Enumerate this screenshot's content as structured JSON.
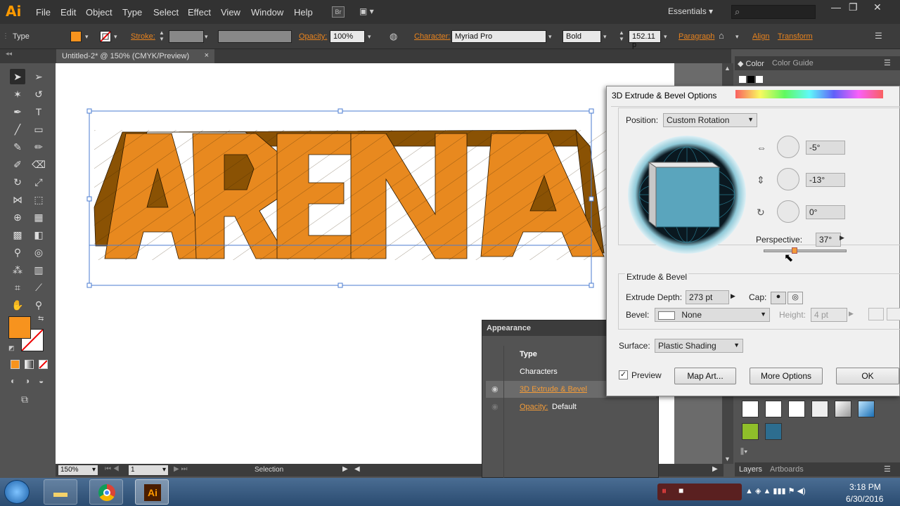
{
  "app": {
    "logo": "Ai",
    "br_label": "Br"
  },
  "menu": [
    "File",
    "Edit",
    "Object",
    "Type",
    "Select",
    "Effect",
    "View",
    "Window",
    "Help"
  ],
  "workspace": "Essentials",
  "control": {
    "mode_label": "Type",
    "stroke_label": "Stroke:",
    "opacity_label": "Opacity:",
    "opacity_value": "100%",
    "character_label": "Character:",
    "font_family": "Myriad Pro",
    "font_style": "Bold",
    "font_size": "152.11 p",
    "paragraph_label": "Paragraph",
    "align_label": "Align",
    "transform_label": "Transform",
    "fill_color": "#f7931e"
  },
  "document_tab": {
    "title": "Untitled-2* @ 150% (CMYK/Preview)",
    "close": "×"
  },
  "artwork": {
    "text": "ARENA",
    "face_color": "#e8891f",
    "side_color": "#8a5204"
  },
  "status": {
    "zoom": "150%",
    "artboard": "1",
    "tool": "Selection"
  },
  "dialog": {
    "title": "3D Extrude & Bevel Options",
    "position_label": "Position:",
    "position_value": "Custom Rotation",
    "rot_x": "-5°",
    "rot_y": "-13°",
    "rot_z": "0°",
    "perspective_label": "Perspective:",
    "perspective_value": "37°",
    "perspective_level": 0.37,
    "extrude_section": "Extrude & Bevel",
    "extrude_depth_label": "Extrude Depth:",
    "extrude_depth_value": "273 pt",
    "cap_label": "Cap:",
    "bevel_label": "Bevel:",
    "bevel_value": "None",
    "height_label": "Height:",
    "height_value": "4 pt",
    "surface_label": "Surface:",
    "surface_value": "Plastic Shading",
    "preview_label": "Preview",
    "preview_checked": true,
    "map_art": "Map Art...",
    "more_options": "More Options",
    "ok": "OK",
    "cube_color": "#5aa5bd"
  },
  "appearance": {
    "title": "Appearance",
    "rows": [
      "Type",
      "Characters",
      "3D Extrude & Bevel"
    ],
    "opacity_label": "Opacity:",
    "opacity_value": "Default"
  },
  "right_panels": {
    "color_tab": "Color",
    "color_guide_tab": "Color Guide",
    "layers_tab": "Layers",
    "artboards_tab": "Artboards"
  },
  "taskbar": {
    "time": "3:18 PM",
    "date": "6/30/2016"
  }
}
